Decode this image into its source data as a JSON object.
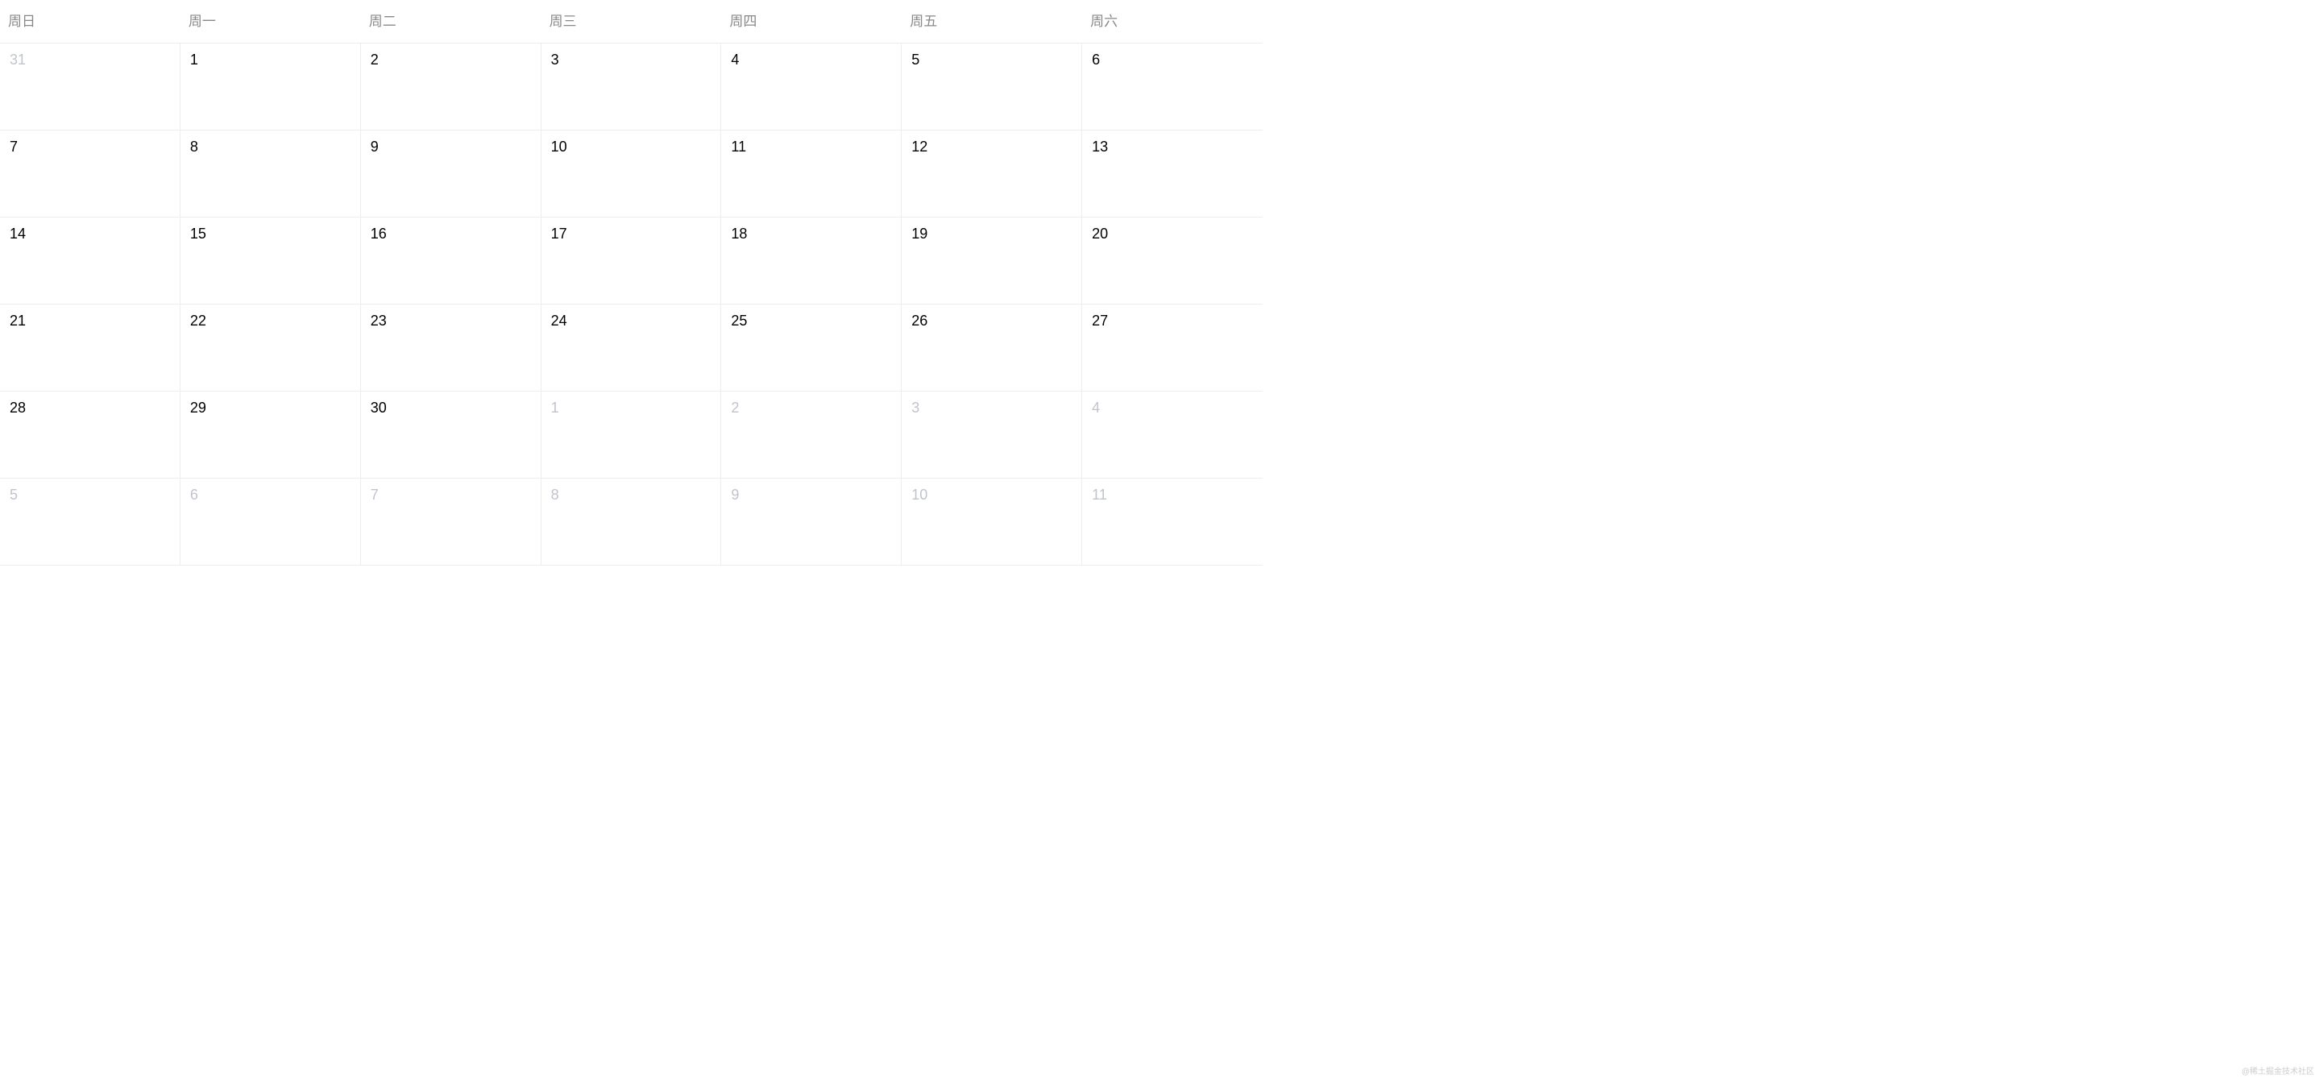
{
  "weekdays": [
    "周日",
    "周一",
    "周二",
    "周三",
    "周四",
    "周五",
    "周六"
  ],
  "days": [
    {
      "label": "31",
      "otherMonth": true
    },
    {
      "label": "1",
      "otherMonth": false
    },
    {
      "label": "2",
      "otherMonth": false
    },
    {
      "label": "3",
      "otherMonth": false
    },
    {
      "label": "4",
      "otherMonth": false
    },
    {
      "label": "5",
      "otherMonth": false
    },
    {
      "label": "6",
      "otherMonth": false
    },
    {
      "label": "7",
      "otherMonth": false
    },
    {
      "label": "8",
      "otherMonth": false
    },
    {
      "label": "9",
      "otherMonth": false
    },
    {
      "label": "10",
      "otherMonth": false
    },
    {
      "label": "11",
      "otherMonth": false
    },
    {
      "label": "12",
      "otherMonth": false
    },
    {
      "label": "13",
      "otherMonth": false
    },
    {
      "label": "14",
      "otherMonth": false
    },
    {
      "label": "15",
      "otherMonth": false
    },
    {
      "label": "16",
      "otherMonth": false
    },
    {
      "label": "17",
      "otherMonth": false
    },
    {
      "label": "18",
      "otherMonth": false
    },
    {
      "label": "19",
      "otherMonth": false
    },
    {
      "label": "20",
      "otherMonth": false
    },
    {
      "label": "21",
      "otherMonth": false
    },
    {
      "label": "22",
      "otherMonth": false
    },
    {
      "label": "23",
      "otherMonth": false
    },
    {
      "label": "24",
      "otherMonth": false
    },
    {
      "label": "25",
      "otherMonth": false
    },
    {
      "label": "26",
      "otherMonth": false
    },
    {
      "label": "27",
      "otherMonth": false
    },
    {
      "label": "28",
      "otherMonth": false
    },
    {
      "label": "29",
      "otherMonth": false
    },
    {
      "label": "30",
      "otherMonth": false
    },
    {
      "label": "1",
      "otherMonth": true
    },
    {
      "label": "2",
      "otherMonth": true
    },
    {
      "label": "3",
      "otherMonth": true
    },
    {
      "label": "4",
      "otherMonth": true
    },
    {
      "label": "5",
      "otherMonth": true
    },
    {
      "label": "6",
      "otherMonth": true
    },
    {
      "label": "7",
      "otherMonth": true
    },
    {
      "label": "8",
      "otherMonth": true
    },
    {
      "label": "9",
      "otherMonth": true
    },
    {
      "label": "10",
      "otherMonth": true
    },
    {
      "label": "11",
      "otherMonth": true
    }
  ],
  "watermark": "@稀土掘金技术社区"
}
